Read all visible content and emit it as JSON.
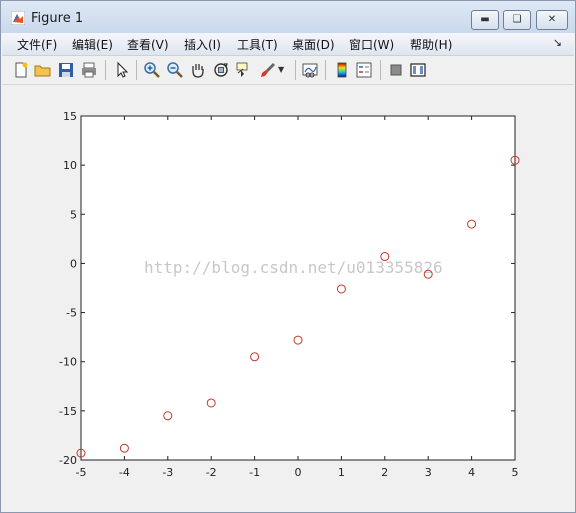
{
  "window": {
    "title": "Figure 1"
  },
  "menu": [
    "文件(F)",
    "编辑(E)",
    "查看(V)",
    "插入(I)",
    "工具(T)",
    "桌面(D)",
    "窗口(W)",
    "帮助(H)"
  ],
  "menu_extra_icon": "dock-arrow-icon",
  "toolbar_icons": [
    "new-figure-icon",
    "open-file-icon",
    "save-icon",
    "print-icon",
    "select-arrow-icon",
    "zoom-in-icon",
    "zoom-out-icon",
    "pan-hand-icon",
    "rotate-3d-icon",
    "data-cursor-icon",
    "brush-icon",
    "brush-dropdown-icon",
    "link-plot-icon",
    "colorbar-icon",
    "legend-icon",
    "hide-plot-tools-icon",
    "show-plot-tools-icon"
  ],
  "watermark": "http://blog.csdn.net/u013355826",
  "colors": {
    "marker": "#c0392b",
    "axes": "#222222",
    "plot_bg": "#ffffff"
  },
  "chart_data": {
    "type": "scatter",
    "marker": "open-circle",
    "xlim": [
      -5,
      5
    ],
    "ylim": [
      -20,
      15
    ],
    "xticks": [
      -5,
      -4,
      -3,
      -2,
      -1,
      0,
      1,
      2,
      3,
      4,
      5
    ],
    "yticks": [
      15,
      10,
      5,
      0,
      -5,
      -10,
      -15,
      -20
    ],
    "x": [
      -5,
      -4,
      -3,
      -2,
      -1,
      0,
      1,
      2,
      3,
      4,
      5
    ],
    "y": [
      -19.3,
      -18.8,
      -15.5,
      -14.2,
      -9.5,
      -7.8,
      -2.6,
      0.7,
      -1.1,
      4.0,
      10.5
    ],
    "grid": false
  }
}
